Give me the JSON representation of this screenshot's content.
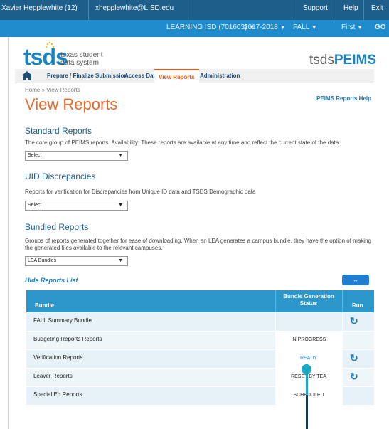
{
  "topbar": {
    "user": "Xavier Hepplewhite (12)",
    "email": "xhepplewhite@LISD.edu",
    "support": "Support",
    "help": "Help",
    "exit": "Exit"
  },
  "subbar": {
    "district": "LEARNING ISD (701603)",
    "year": "2017-2018",
    "term": "FALL",
    "submission": "First",
    "go": "GO"
  },
  "logo": {
    "brand": "tsds",
    "line1": "texas student",
    "line2": "data system",
    "peims_prefix": "tsds",
    "peims_suffix": "PEIMS"
  },
  "nav": {
    "tabs": [
      {
        "label": "Prepare / Finalize Submission"
      },
      {
        "label": "Access Data"
      },
      {
        "label": "View Reports"
      },
      {
        "label": "Administration"
      }
    ]
  },
  "breadcrumb": "Home » View Reports",
  "page_title": "View Reports",
  "help_link": "PEIMS Reports Help",
  "standard": {
    "heading": "Standard Reports",
    "desc": "The core group of PEIMS reports. Availability: These reports are available at any time and reflect the current state of the data.",
    "select_value": "Select"
  },
  "uid": {
    "heading": "UID Discrepancies",
    "desc": "Reports for verification for Discrepancies from Unique ID data and TSDS Demographic data",
    "select_value": "Select"
  },
  "bundled": {
    "heading": "Bundled Reports",
    "desc": "Groups of reports generated together for ease of downloading. When an LEA generates a campus bundle, they have the option of making the generated files available to the relevant campuses.",
    "select_value": "LEA Bundles"
  },
  "hide_link": "Hide Reports List",
  "toggle_label": "↔",
  "table": {
    "headers": {
      "bundle": "Bundle",
      "status": "Bundle Generation Status",
      "run": "Run"
    },
    "rows": [
      {
        "bundle": "FALL Summary Bundle",
        "status": "",
        "run": true
      },
      {
        "bundle": "Budgeting Reports Reports",
        "status": "IN PROGRESS",
        "run": false
      },
      {
        "bundle": "Verification Reports",
        "status": "READY",
        "run": true
      },
      {
        "bundle": "Leaver Reports",
        "status": "RESET BY TEA",
        "run": true
      },
      {
        "bundle": "Special Ed Reports",
        "status": "SCHEDULED",
        "run": false
      }
    ]
  },
  "colors": {
    "topbar": "#1d5f8a",
    "subbar": "#1f8bcc",
    "accent_orange": "#e86a2c",
    "table_header": "#2b97cb",
    "pointer": "#19a8c4"
  }
}
